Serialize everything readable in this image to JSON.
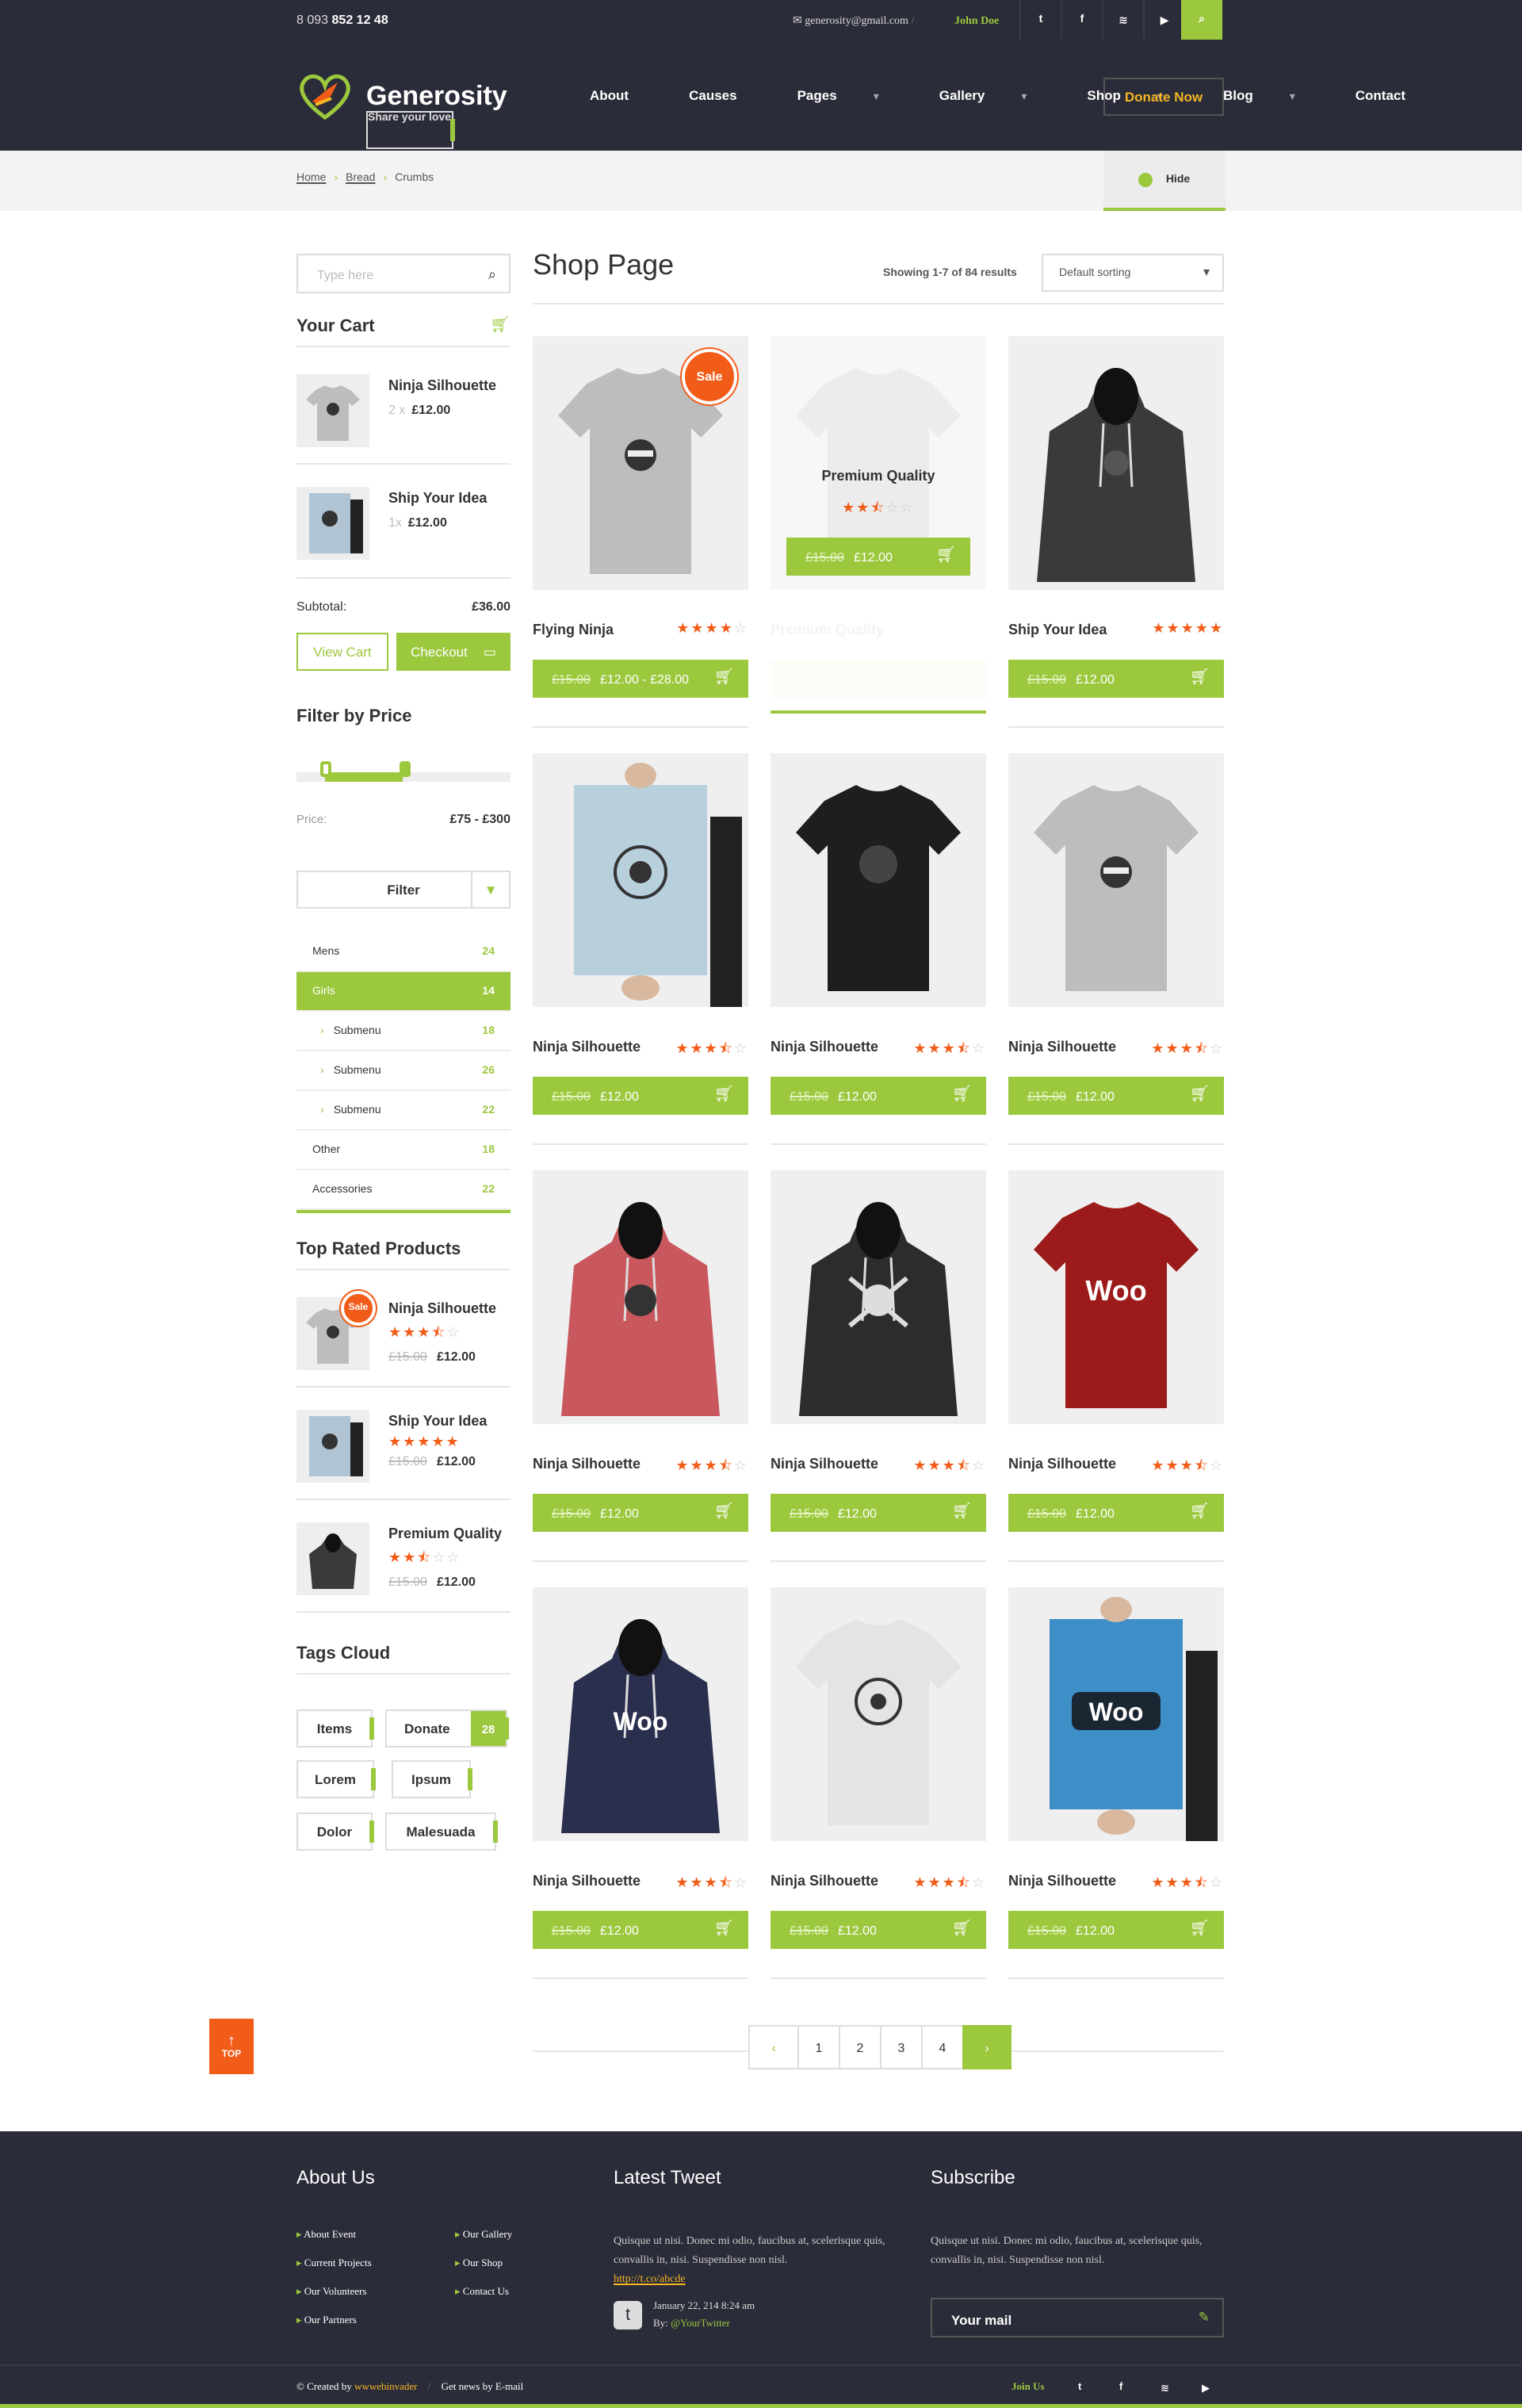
{
  "topbar": {
    "phone_prefix": "8 093",
    "phone_bold": "852 12 48",
    "email": "generosity@gmail.com",
    "separator": "/",
    "user": "John Doe",
    "social": [
      "twitter-icon",
      "facebook-icon",
      "rss-icon",
      "youtube-icon"
    ],
    "social_glyphs": [
      "t",
      "f",
      "≋",
      "▶"
    ],
    "search_glyph": "⌕"
  },
  "header": {
    "logo_name": "Generosity",
    "logo_tagline": "Share your love",
    "nav": [
      "About",
      "Causes",
      "Pages",
      "Gallery",
      "Shop",
      "Blog",
      "Contact"
    ],
    "nav_dropdowns": [
      false,
      false,
      true,
      true,
      true,
      true,
      false
    ],
    "donate_label": "Donate Now"
  },
  "breadcrumb": {
    "items": [
      "Home",
      "Bread",
      "Crumbs"
    ],
    "hide_label": "Hide"
  },
  "sidebar": {
    "search_placeholder": "Type here",
    "cart_title": "Your Cart",
    "cart_items": [
      {
        "name": "Ninja Silhouette",
        "qty": "2 x",
        "price": "£12.00"
      },
      {
        "name": "Ship Your Idea",
        "qty": "1x",
        "price": "£12.00"
      }
    ],
    "subtotal_label": "Subtotal:",
    "subtotal_value": "£36.00",
    "view_cart_label": "View Cart",
    "checkout_label": "Checkout",
    "filter_title": "Filter by Price",
    "price_label": "Price:",
    "price_range": "£75 - £300",
    "price_slider": {
      "min_fraction": 0.13,
      "max_fraction": 0.5
    },
    "filter_button": "Filter",
    "categories": [
      {
        "label": "Mens",
        "count": "24",
        "sub": false,
        "active": false
      },
      {
        "label": "Girls",
        "count": "14",
        "sub": false,
        "active": true
      },
      {
        "label": "Submenu",
        "count": "18",
        "sub": true,
        "active": false
      },
      {
        "label": "Submenu",
        "count": "26",
        "sub": true,
        "active": false
      },
      {
        "label": "Submenu",
        "count": "22",
        "sub": true,
        "active": false
      },
      {
        "label": "Other",
        "count": "18",
        "sub": false,
        "active": false
      },
      {
        "label": "Accessories",
        "count": "22",
        "sub": false,
        "active": false
      }
    ],
    "top_rated_title": "Top Rated Products",
    "top_rated": [
      {
        "name": "Ninja Silhouette",
        "rating": 3.5,
        "old_price": "£15.00",
        "price": "£12.00",
        "sale_label": "Sale"
      },
      {
        "name": "Ship Your Idea",
        "rating": 5,
        "old_price": "£15.00",
        "price": "£12.00"
      },
      {
        "name": "Premium Quality",
        "rating": 2.5,
        "old_price": "£15.00",
        "price": "£12.00"
      }
    ],
    "tags_title": "Tags  Cloud",
    "tags": [
      "Items",
      "Donate",
      "Lorem",
      "Ipsum",
      "Dolor",
      "Malesuada"
    ],
    "donate_tag_count": "28"
  },
  "main": {
    "title": "Shop Page",
    "showing": "Showing 1-7 of 84 results",
    "sort_value": "Default sorting",
    "overlay": {
      "name": "Premium Quality",
      "rating": 2.5,
      "old_price": "£15.00",
      "price": "£12.00"
    },
    "products": [
      {
        "name": "Flying Ninja",
        "rating": 4,
        "old_price": "£15.00",
        "price": "£12.00 - £28.00",
        "sale": "Sale",
        "kind": "tee-grey"
      },
      {
        "name": "Premium Quality",
        "rating": 2.5,
        "old_price": "£15.00",
        "price": "£12.00",
        "kind": "hover"
      },
      {
        "name": "Ship Your Idea",
        "rating": 5,
        "old_price": "£15.00",
        "price": "£12.00",
        "kind": "hoodie-black"
      },
      {
        "name": "Ninja Silhouette",
        "rating": 3.5,
        "old_price": "£15.00",
        "price": "£12.00",
        "kind": "poster-light"
      },
      {
        "name": "Ninja Silhouette",
        "rating": 3.5,
        "old_price": "£15.00",
        "price": "£12.00",
        "kind": "tee-black"
      },
      {
        "name": "Ninja Silhouette",
        "rating": 3.5,
        "old_price": "£15.00",
        "price": "£12.00",
        "kind": "tee-grey"
      },
      {
        "name": "Ninja Silhouette",
        "rating": 3.5,
        "old_price": "£15.00",
        "price": "£12.00",
        "kind": "hoodie-red"
      },
      {
        "name": "Ninja Silhouette",
        "rating": 3.5,
        "old_price": "£15.00",
        "price": "£12.00",
        "kind": "hoodie-skull"
      },
      {
        "name": "Ninja Silhouette",
        "rating": 3.5,
        "old_price": "£15.00",
        "price": "£12.00",
        "kind": "tee-red"
      },
      {
        "name": "Ninja Silhouette",
        "rating": 3.5,
        "old_price": "£15.00",
        "price": "£12.00",
        "kind": "hoodie-navy"
      },
      {
        "name": "Ninja Silhouette",
        "rating": 3.5,
        "old_price": "£15.00",
        "price": "£12.00",
        "kind": "tee-white"
      },
      {
        "name": "Ninja Silhouette",
        "rating": 3.5,
        "old_price": "£15.00",
        "price": "£12.00",
        "kind": "poster-blue"
      }
    ],
    "pages": [
      "1",
      "2",
      "3",
      "4"
    ],
    "top_label": "TOP"
  },
  "footer": {
    "about_title": "About Us",
    "links_col1": [
      "About Event",
      "Current Projects",
      "Our Volunteers",
      "Our Partners"
    ],
    "links_col2": [
      "Our Gallery",
      "Our Shop",
      "Contact Us"
    ],
    "tweet_title": "Latest Tweet",
    "tweet_text": "Quisque ut nisi. Donec mi odio, faucibus at, scelerisque quis, convallis in, nisi. Suspendisse non nisl.",
    "tweet_link": "http://t.co/abcde",
    "tweet_date": "January 22, 214 8:24 am",
    "tweet_by": "By:",
    "tweet_handle": "@YourTwitter",
    "subscribe_title": "Subscribe",
    "subscribe_text": "Quisque ut nisi. Donec mi odio, faucibus at, scelerisque quis, convallis in, nisi. Suspendisse non nisl.",
    "mail_placeholder": "Your mail",
    "created_by": "© Created by",
    "author": "wwwebinvader",
    "sep": "/",
    "news": "Get news by E-mail",
    "join": "Join Us"
  },
  "colors": {
    "accent": "#9cc83e",
    "sale": "#f25c19",
    "dark": "#2b2c39",
    "gold": "#f5b721"
  }
}
